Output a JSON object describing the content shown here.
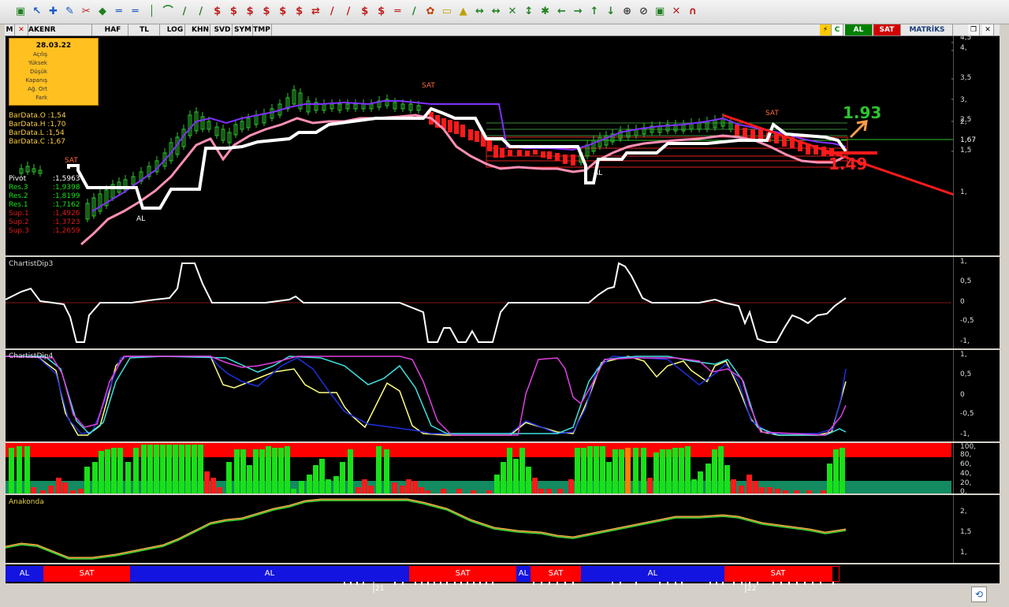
{
  "tabs": {
    "symbol": "AKENR",
    "items": [
      "HAF",
      "TL",
      "LOG",
      "KHN",
      "SVD",
      "SYM",
      "TMP"
    ],
    "al": "AL",
    "sat": "SAT",
    "brand": "MATRİKS",
    "c": "C"
  },
  "info_box": {
    "date": "28.03.22",
    "rows": [
      "Açılış",
      "Yüksek",
      "Düşük",
      "Kapanış",
      "Ağ. Ort",
      "Fark"
    ]
  },
  "bardata": [
    "BarData.O :1,54",
    "BarData.H :1,70",
    "BarData.L :1,54",
    "BarData.C :1,67"
  ],
  "pivots": [
    {
      "label": "Pivot",
      "value": ":1,5963",
      "color": "#ffffff"
    },
    {
      "label": "Res.3",
      "value": ":1,9398",
      "color": "#19e019"
    },
    {
      "label": "Res.2",
      "value": ":1,8199",
      "color": "#19e019"
    },
    {
      "label": "Res.1",
      "value": ":1,7162",
      "color": "#19e019"
    },
    {
      "label": "Sup.1",
      "value": ":1,4926",
      "color": "#e01919"
    },
    {
      "label": "Sup.2",
      "value": ":1,3723",
      "color": "#e01919"
    },
    {
      "label": "Sup.3",
      "value": ":1,2659",
      "color": "#e01919"
    }
  ],
  "price_axis": [
    "4,5",
    "4,",
    "3,5",
    "3,",
    "2,5",
    "2,",
    "1,67",
    "1,5",
    "1,"
  ],
  "annotations": {
    "target_up": "1.93",
    "target_down": "1.49",
    "sat": "SAT",
    "al": "AL"
  },
  "panels": {
    "chartist3": "ChartistDip3",
    "chartist4": "ChartistDip4",
    "anakonda": "Anakonda"
  },
  "osc_axis": [
    "1,",
    "0,5",
    "0",
    "-0,5",
    "-1,"
  ],
  "vol_axis": [
    "100,",
    "80,",
    "60,",
    "40,",
    "20,",
    "0,"
  ],
  "anak_axis": [
    "2,",
    "1,5",
    "1,"
  ],
  "timebar": [
    {
      "label": "AL",
      "color": "#1414e0"
    },
    {
      "label": "SAT",
      "color": "#ff0000"
    },
    {
      "label": "AL",
      "color": "#1414e0"
    },
    {
      "label": "SAT",
      "color": "#ff0000"
    },
    {
      "label": "AL",
      "color": "#1414e0"
    },
    {
      "label": "SAT",
      "color": "#ff0000"
    },
    {
      "label": "AL",
      "color": "#1414e0"
    },
    {
      "label": "SAT",
      "color": "#ff0000"
    }
  ],
  "date_labels": [
    "21",
    "22"
  ],
  "colors": {
    "bull": "#19e019",
    "bear": "#ff0000",
    "accent": "#ffc020"
  }
}
